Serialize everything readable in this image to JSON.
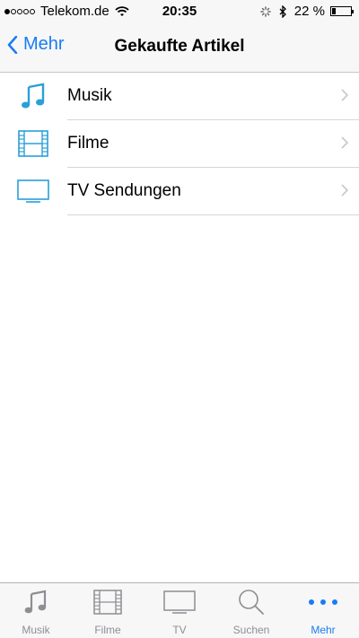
{
  "status_bar": {
    "carrier": "Telekom.de",
    "time": "20:35",
    "battery": "22 %",
    "battery_level": 0.22
  },
  "nav": {
    "back_label": "Mehr",
    "title": "Gekaufte Artikel"
  },
  "list": {
    "items": [
      {
        "label": "Musik",
        "icon": "music-note-icon"
      },
      {
        "label": "Filme",
        "icon": "film-strip-icon"
      },
      {
        "label": "TV Sendungen",
        "icon": "tv-icon"
      }
    ]
  },
  "tab_bar": {
    "tabs": [
      {
        "label": "Musik",
        "icon": "music-note-icon"
      },
      {
        "label": "Filme",
        "icon": "film-strip-icon"
      },
      {
        "label": "TV",
        "icon": "tv-icon"
      },
      {
        "label": "Suchen",
        "icon": "search-icon"
      },
      {
        "label": "Mehr",
        "icon": "more-dots-icon"
      }
    ],
    "active": "Mehr"
  },
  "colors": {
    "accent": "#1a7cf2",
    "list_icon": "#2a9fd8",
    "tab_inactive": "#8e8e93"
  }
}
